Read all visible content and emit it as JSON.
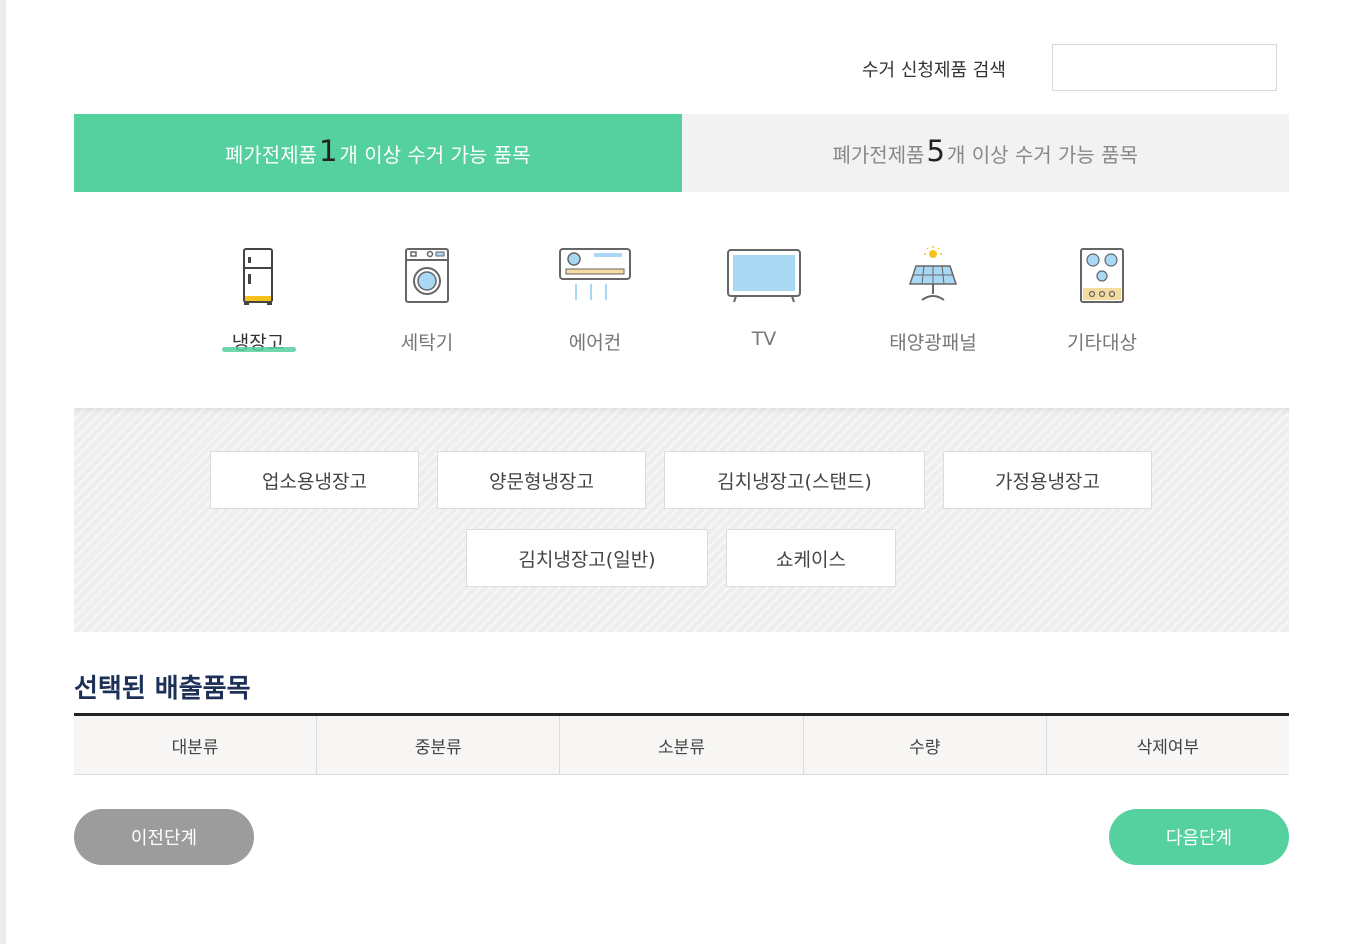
{
  "search": {
    "label": "수거 신청제품 검색",
    "value": "",
    "placeholder": ""
  },
  "tabs": [
    {
      "pre": "폐가전제품 ",
      "num": "1",
      "post": "개 이상 수거 가능 품목"
    },
    {
      "pre": "폐가전제품 ",
      "num": "5",
      "post": "개 이상 수거 가능 품목"
    }
  ],
  "categories": [
    {
      "label": "냉장고",
      "icon": "refrigerator-icon"
    },
    {
      "label": "세탁기",
      "icon": "washing-machine-icon"
    },
    {
      "label": "에어컨",
      "icon": "air-conditioner-icon"
    },
    {
      "label": "TV",
      "icon": "tv-icon"
    },
    {
      "label": "태양광패널",
      "icon": "solar-panel-icon"
    },
    {
      "label": "기타대상",
      "icon": "gas-stove-icon"
    }
  ],
  "subcategories": [
    "업소용냉장고",
    "양문형냉장고",
    "김치냉장고(스탠드)",
    "가정용냉장고",
    "김치냉장고(일반)",
    "쇼케이스"
  ],
  "selected": {
    "title": "선택된 배출품목",
    "columns": [
      "대분류",
      "중분류",
      "소분류",
      "수량",
      "삭제여부"
    ]
  },
  "buttons": {
    "prev": "이전단계",
    "next": "다음단계"
  },
  "colors": {
    "accent": "#55d09f",
    "title": "#1d3158",
    "prev_button": "#9c9c9c"
  }
}
